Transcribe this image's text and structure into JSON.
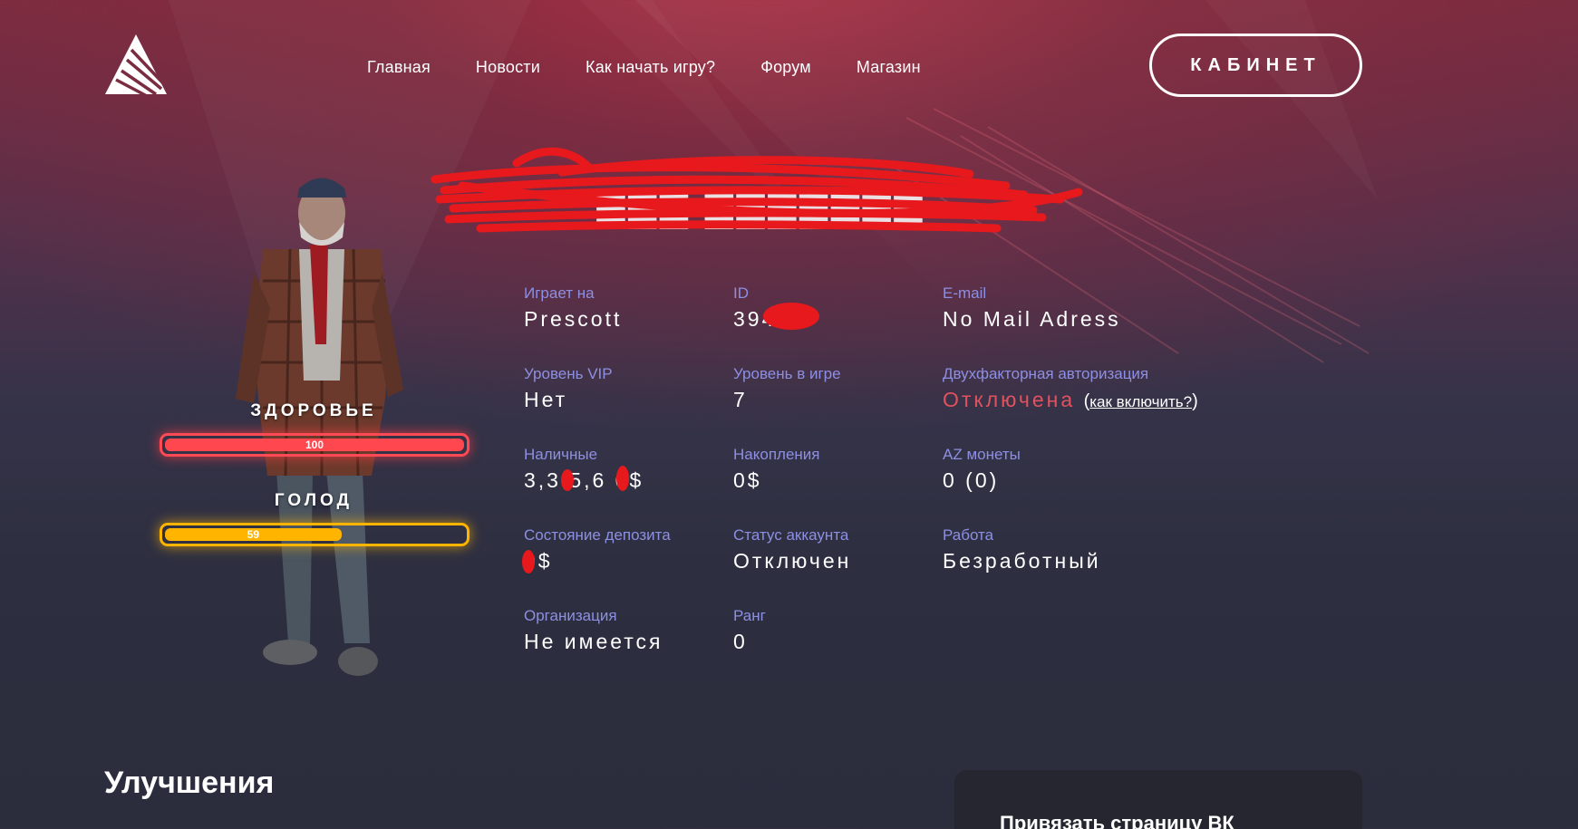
{
  "header": {
    "logo": "brand-logo",
    "nav": [
      "Главная",
      "Новости",
      "Как начать игру?",
      "Форум",
      "Магазин"
    ],
    "cabinet_label": "КАБИНЕТ"
  },
  "player": {
    "name": "redacted"
  },
  "bars": {
    "health": {
      "title": "ЗДОРОВЬЕ",
      "value": "100",
      "fraction": 1.0,
      "color": "#ff474f"
    },
    "hunger": {
      "title": "ГОЛОД",
      "value": "59",
      "fraction": 0.59,
      "color": "#ffb500"
    }
  },
  "stats": {
    "server": {
      "label": "Играет на",
      "value": "Prescott"
    },
    "id": {
      "label": "ID",
      "value": "394"
    },
    "email": {
      "label": "E-mail",
      "value": "No Mail Adress"
    },
    "vip": {
      "label": "Уровень VIP",
      "value": "Нет"
    },
    "level": {
      "label": "Уровень в игре",
      "value": "7"
    },
    "twofa": {
      "label": "Двухфакторная авторизация",
      "status": "Отключена",
      "open": "(",
      "link": "как включить?",
      "close": ")"
    },
    "cash": {
      "label": "Наличные",
      "value": "3,3 5,6 0$"
    },
    "savings": {
      "label": "Накопления",
      "value": "0$"
    },
    "az": {
      "label": "AZ монеты",
      "value": "0 (0)"
    },
    "deposit": {
      "label": "Состояние депозита",
      "value": "0$"
    },
    "account": {
      "label": "Статус аккаунта",
      "value": "Отключен"
    },
    "job": {
      "label": "Работа",
      "value": "Безработный"
    },
    "org": {
      "label": "Организация",
      "value": "Не имеется"
    },
    "rank": {
      "label": "Ранг",
      "value": "0"
    }
  },
  "sections": {
    "upgrades_title": "Улучшения",
    "vk_card_text": "Привязать страницу ВК"
  },
  "colors": {
    "accent_label": "#8d8fe3",
    "danger": "#e0525e",
    "redaction": "#e8191c"
  }
}
